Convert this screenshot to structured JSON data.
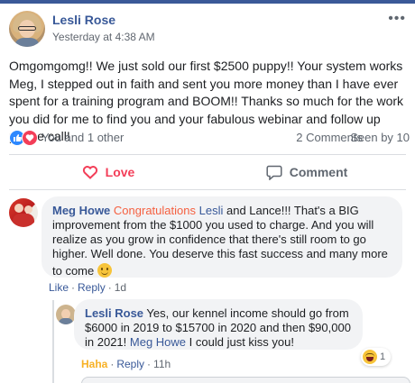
{
  "post": {
    "author": "Lesli Rose",
    "timestamp": "Yesterday at 4:38 AM",
    "more_glyph": "•••",
    "text": "Omgomgomg!! We just sold our first $2500 puppy!! Your system works Meg, I stepped out in faith and sent you more money than I have ever spent for a training program and BOOM!! Thanks so much for the work you did for me to find you and your fabulous webinar and follow up phone call!",
    "reactions_text": "You and 1 other",
    "comments_count": "2 Comments",
    "seen_by": "Seen by 10"
  },
  "actions": {
    "love_label": "Love",
    "comment_label": "Comment"
  },
  "comments": {
    "meg": {
      "author": "Meg Howe",
      "mention": "Congratulations",
      "text_1": "Lesli",
      "text_2": "and Lance!!! That's a BIG improvement from the $1000 you used to charge. And you will realize as you grow in confidence that there's still room to go higher. Well done. You deserve this fast success and many more to come",
      "like_label": "Like",
      "reply_label": "Reply",
      "time": "1d"
    },
    "lesli_reply": {
      "author": "Lesli Rose",
      "text": "Yes, our kennel income should go from $6000 in 2019 to $15700 in 2020 and then $90,000 in 2021!",
      "mention": "Meg Howe",
      "text_end": "I could just kiss you!",
      "haha_label": "Haha",
      "reply_label": "Reply",
      "time": "11h",
      "reaction_count": "1"
    }
  },
  "colors": {
    "brand_blue": "#385898",
    "love_red": "#f33e58",
    "like_blue": "#2d88ff",
    "haha_yellow": "#f7b125",
    "bubble_gray": "#f2f3f5"
  }
}
